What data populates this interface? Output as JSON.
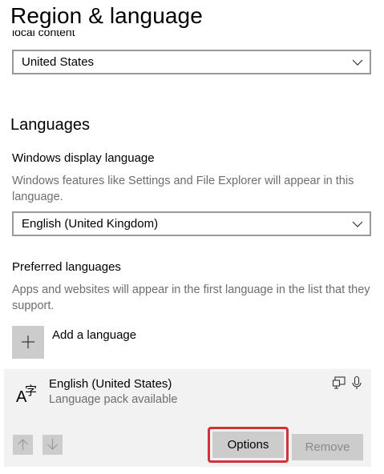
{
  "page": {
    "title": "Region & language"
  },
  "region": {
    "clipped_label": "local content",
    "country_value": "United States"
  },
  "languages": {
    "heading": "Languages",
    "display_language_label": "Windows display language",
    "display_language_desc": "Windows features like Settings and File Explorer will appear in this language.",
    "display_language_value": "English (United Kingdom)",
    "preferred_label": "Preferred languages",
    "preferred_desc": "Apps and websites will appear in the first language in the list that they support.",
    "add_language_label": "Add a language",
    "items": [
      {
        "name": "English (United States)",
        "status": "Language pack available",
        "glyph_latin": "A",
        "glyph_cjk": "字"
      }
    ],
    "options_label": "Options",
    "remove_label": "Remove"
  },
  "colors": {
    "accent_highlight": "#d13438",
    "button_bg": "#cccccc",
    "panel_bg": "#f2f2f2",
    "secondary_text": "#6d6d6d"
  }
}
